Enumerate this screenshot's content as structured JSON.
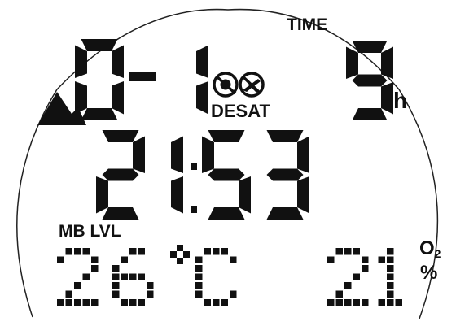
{
  "display": {
    "time_label": "TIME",
    "altitude_class": "0-1",
    "altitude_icon": "mountain-icon",
    "no_dive_icon": "no-dive-icon",
    "no_fly_icon": "no-fly-icon",
    "desat_label": "DESAT",
    "desat_hours": "9",
    "hours_unit": "h",
    "clock": "21:53",
    "mb_level_label": "MB LVL",
    "temperature": "26",
    "temperature_unit": "°C",
    "oxygen_percent": "21",
    "o2_label": "O",
    "o2_subscript": "2",
    "percent_label": "%"
  }
}
